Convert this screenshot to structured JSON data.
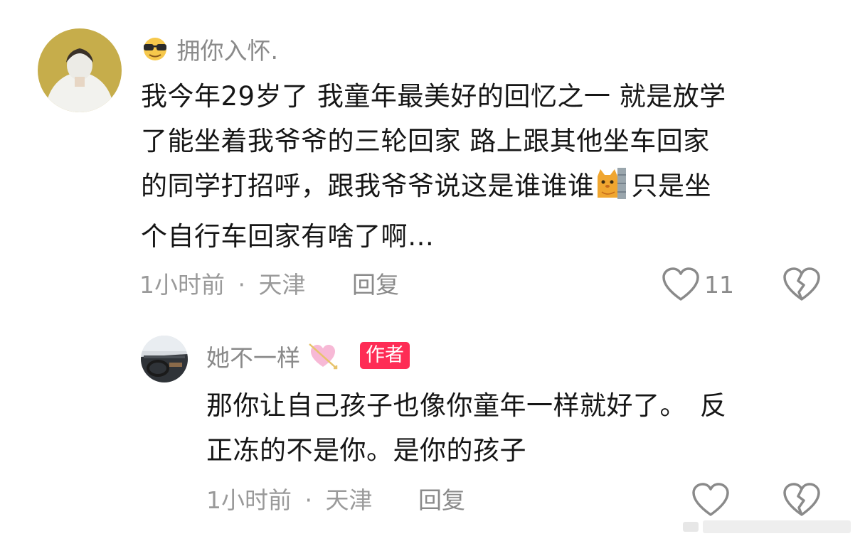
{
  "comment": {
    "username": "拥你入怀.",
    "username_emoji": "sunglasses-face-emoji",
    "lines": [
      "我今年29岁了 我童年最美好的回忆之一 就是放学",
      "了能坐着我爷爷的三轮回家 路上跟其他坐车回家",
      "的同学打招呼，跟我爷爷说这是谁谁谁",
      "只是坐",
      "个自行车回家有啥了啊…"
    ],
    "inline_emoji": "cat-peeking-wall-emoji",
    "time": "1小时前",
    "separator": "·",
    "location": "天津",
    "reply_label": "回复",
    "like_count": "11"
  },
  "reply": {
    "username": "她不一样",
    "username_emoji": "heart-with-arrow-emoji",
    "author_badge": "作者",
    "lines": [
      "那你让自己孩子也像你童年一样就好了。　反",
      "正冻的不是你。是你的孩子"
    ],
    "time": "1小时前",
    "separator": "·",
    "location": "天津",
    "reply_label": "回复"
  },
  "colors": {
    "badge": "#fe2c55",
    "meta_text": "#9a9a9a",
    "body_text": "#161616"
  }
}
